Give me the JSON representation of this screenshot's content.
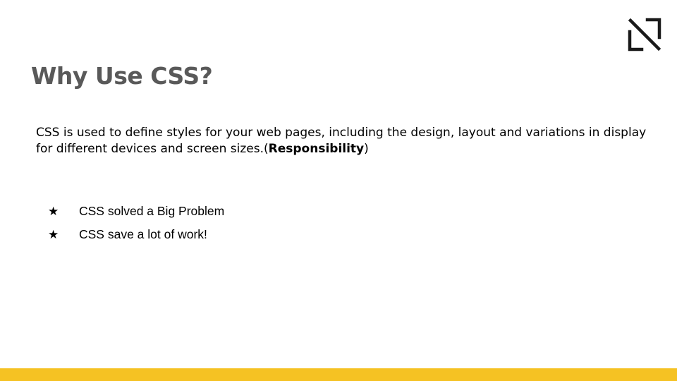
{
  "slide": {
    "title": "Why Use CSS?",
    "paragraph": {
      "text_before": "CSS is used to define styles for your web pages, including the design, layout and variations in display for different devices and screen sizes.(",
      "bold": "Responsibility",
      "text_after": ")"
    },
    "bullets": [
      {
        "marker": "★",
        "text": "CSS solved a Big Problem"
      },
      {
        "marker": "★",
        "text": "CSS save a lot of work!"
      }
    ]
  },
  "colors": {
    "title": "#595959",
    "accent_bar": "#f5c223",
    "logo": "#1a1a1a"
  },
  "icons": {
    "logo": "brand-logo-icon",
    "bullet": "star-icon"
  }
}
